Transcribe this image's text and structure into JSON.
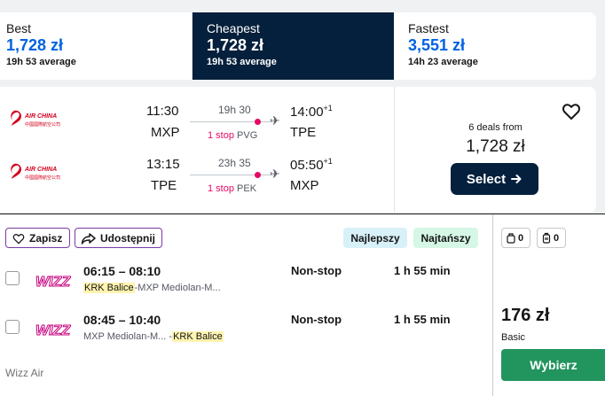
{
  "sort_tabs": [
    {
      "name": "Best",
      "price": "1,728 zł",
      "avg": "19h 53 average"
    },
    {
      "name": "Cheapest",
      "price": "1,728 zł",
      "avg": "19h 53 average"
    },
    {
      "name": "Fastest",
      "price": "3,551 zł",
      "avg": "14h 23 average"
    }
  ],
  "active_tab": "Cheapest",
  "result": {
    "legs": [
      {
        "airline_logo_text": "AIR CHINA",
        "dep_time": "11:30",
        "dep_code": "MXP",
        "duration": "19h 30",
        "stops_label": "1 stop",
        "stop_airport": "PVG",
        "arr_time": "14:00",
        "arr_offset": "+1",
        "arr_code": "TPE"
      },
      {
        "airline_logo_text": "AIR CHINA",
        "dep_time": "13:15",
        "dep_code": "TPE",
        "duration": "23h 35",
        "stops_label": "1 stop",
        "stop_airport": "PEK",
        "arr_time": "05:50",
        "arr_offset": "+1",
        "arr_code": "MXP"
      }
    ],
    "deals": "6 deals from",
    "price": "1,728 zł",
    "select_label": "Select",
    "icons": {
      "favorite": "heart-outline-icon",
      "arrow": "arrow-right-icon",
      "plane": "plane-icon"
    }
  },
  "wizz": {
    "save_label": "Zapisz",
    "share_label": "Udostępnij",
    "tag_best": "Najlepszy",
    "tag_cheapest": "Najtańszy",
    "legs": [
      {
        "times": "06:15 – 08:10",
        "route_hl": "KRK Balice",
        "route_rest": "-MXP Mediolan-M...",
        "stops": "Non-stop",
        "duration": "1 h 55 min"
      },
      {
        "times": "08:45 – 10:40",
        "route_rest": "MXP Mediolan-M...",
        "route_sep": " -",
        "route_hl": "KRK Balice",
        "stops": "Non-stop",
        "duration": "1 h 55 min"
      }
    ],
    "airline_name": "Wizz Air",
    "logo_text": "WIZZ",
    "bag_cabin": "0",
    "bag_checked": "0",
    "price": "176 zł",
    "fare": "Basic",
    "select_label": "Wybierz",
    "colors": {
      "brand": "#c6007e",
      "green": "#22945e",
      "purple": "#7c3aa3"
    }
  }
}
